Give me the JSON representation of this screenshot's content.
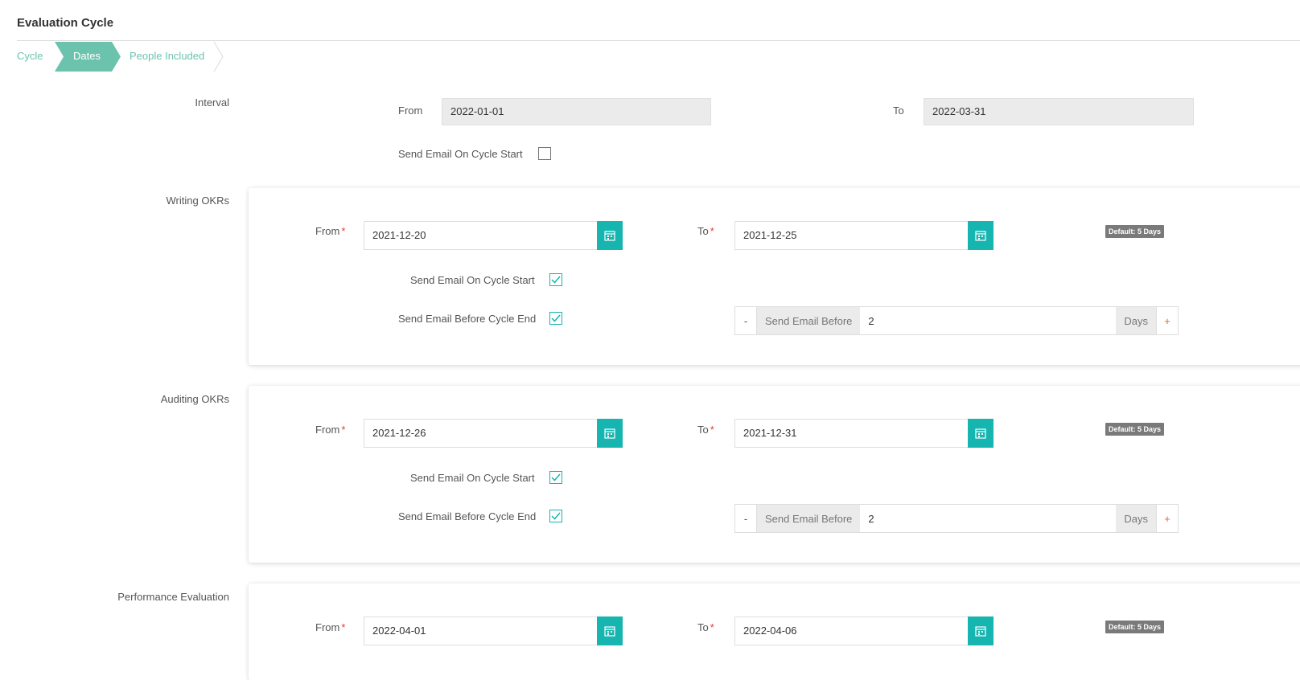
{
  "page": {
    "title": "Evaluation Cycle"
  },
  "wizard": {
    "steps": [
      "Cycle",
      "Dates",
      "People Included"
    ],
    "active": "Dates"
  },
  "interval": {
    "label": "Interval",
    "from_label": "From",
    "from_value": "2022-01-01",
    "to_label": "To",
    "to_value": "2022-03-31",
    "send_email_start_label": "Send Email On Cycle Start",
    "send_email_start_checked": false
  },
  "sections": [
    {
      "label": "Writing OKRs",
      "from_label": "From",
      "from_value": "2021-12-20",
      "to_label": "To",
      "to_value": "2021-12-25",
      "default_badge": "Default: 5 Days",
      "send_start_label": "Send Email On Cycle Start",
      "send_before_label": "Send Email Before Cycle End",
      "stepper": {
        "minus": "-",
        "addon": "Send Email Before",
        "value": "2",
        "unit": "Days",
        "plus": "+"
      }
    },
    {
      "label": "Auditing OKRs",
      "from_label": "From",
      "from_value": "2021-12-26",
      "to_label": "To",
      "to_value": "2021-12-31",
      "default_badge": "Default: 5 Days",
      "send_start_label": "Send Email On Cycle Start",
      "send_before_label": "Send Email Before Cycle End",
      "stepper": {
        "minus": "-",
        "addon": "Send Email Before",
        "value": "2",
        "unit": "Days",
        "plus": "+"
      }
    },
    {
      "label": "Performance Evaluation",
      "from_label": "From",
      "from_value": "2022-04-01",
      "to_label": "To",
      "to_value": "2022-04-06",
      "default_badge": "Default: 5 Days"
    }
  ],
  "colors": {
    "accent": "#16b5b0",
    "step_active": "#6cc3ad",
    "required": "#e53935"
  },
  "icons": {
    "calendar": "calendar-icon",
    "check": "check-icon"
  }
}
